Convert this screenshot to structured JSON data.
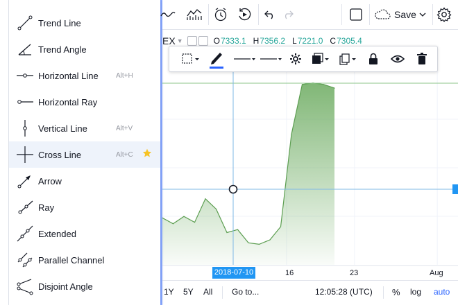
{
  "tools_menu": {
    "items": [
      {
        "label": "Trend Line",
        "icon": "trend-line-icon",
        "hotkey": ""
      },
      {
        "label": "Trend Angle",
        "icon": "trend-angle-icon",
        "hotkey": ""
      },
      {
        "label": "Horizontal Line",
        "icon": "horizontal-line-icon",
        "hotkey": "Alt+H"
      },
      {
        "label": "Horizontal Ray",
        "icon": "horizontal-ray-icon",
        "hotkey": ""
      },
      {
        "label": "Vertical Line",
        "icon": "vertical-line-icon",
        "hotkey": "Alt+V"
      },
      {
        "label": "Cross Line",
        "icon": "cross-line-icon",
        "hotkey": "Alt+C",
        "favorite": true,
        "active": true
      },
      {
        "label": "Arrow",
        "icon": "arrow-icon",
        "hotkey": ""
      },
      {
        "label": "Ray",
        "icon": "ray-icon",
        "hotkey": ""
      },
      {
        "label": "Extended",
        "icon": "extended-line-icon",
        "hotkey": ""
      },
      {
        "label": "Parallel Channel",
        "icon": "parallel-channel-icon",
        "hotkey": ""
      },
      {
        "label": "Disjoint Angle",
        "icon": "disjoint-angle-icon",
        "hotkey": ""
      }
    ]
  },
  "toolbar": {
    "save_label": "Save",
    "icons": [
      "chart-type-icon",
      "indicators-icon",
      "alert-icon",
      "replay-icon",
      "undo-icon",
      "redo-icon",
      "fullscreen-icon",
      "cloud-icon",
      "chevron-down-icon",
      "settings-icon"
    ]
  },
  "legend": {
    "symbol_suffix": "EX",
    "open_label": "O",
    "open": "7333.1",
    "high_label": "H",
    "high": "7356.2",
    "low_label": "L",
    "low": "7221.0",
    "close_label": "C",
    "close": "7305.4"
  },
  "drawing_toolbar": {
    "icons": [
      "select-area-icon",
      "pencil-icon",
      "line-style-icon",
      "line-width-icon",
      "gear-icon",
      "template-icon",
      "clone-icon",
      "lock-icon",
      "eye-icon",
      "trash-icon"
    ],
    "accent": "#2962ff"
  },
  "chart_data": {
    "type": "area",
    "x": [
      "2018-07-05",
      "2018-07-06",
      "2018-07-07",
      "2018-07-08",
      "2018-07-09",
      "2018-07-10",
      "2018-07-11",
      "2018-07-12",
      "2018-07-13",
      "2018-07-14",
      "2018-07-15",
      "2018-07-16",
      "2018-07-17",
      "2018-07-18",
      "2018-07-19",
      "2018-07-20",
      "2018-07-21"
    ],
    "values": [
      6420,
      6380,
      6430,
      6390,
      6550,
      6480,
      6320,
      6340,
      6250,
      6240,
      6270,
      6360,
      6990,
      7330,
      7340,
      7330,
      7305
    ],
    "title": "",
    "xlabel": "",
    "ylabel": "",
    "fill_color": "#6aaa5e",
    "line_color": "#5c9e51",
    "x_ticks": [
      "16",
      "23",
      "Aug"
    ],
    "crosshair_date": "2018-07-10",
    "grid": true
  },
  "bottom_bar": {
    "ranges": [
      "1Y",
      "5Y",
      "All"
    ],
    "goto_label": "Go to...",
    "clock": "12:05:28 (UTC)",
    "percent_label": "%",
    "log_label": "log",
    "auto_label": "auto"
  }
}
